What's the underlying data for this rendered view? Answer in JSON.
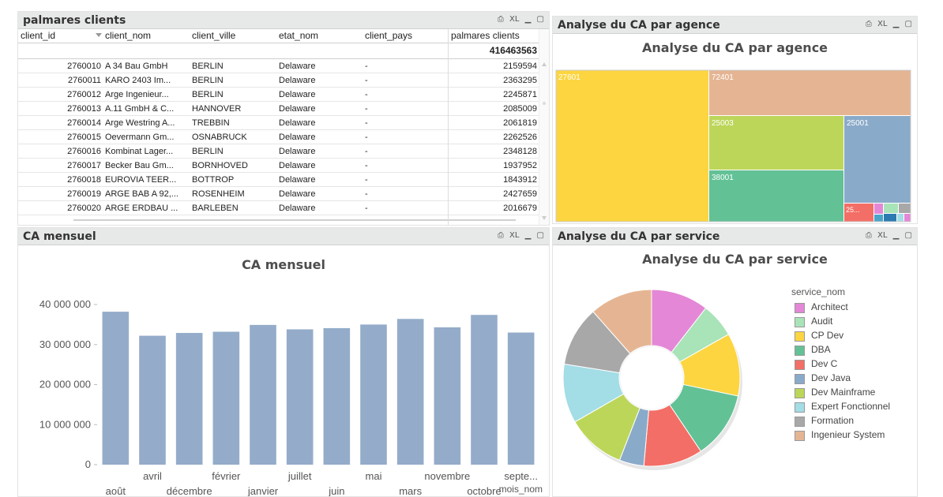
{
  "palmares": {
    "title": "palmares clients",
    "tools": {
      "print": "⎙",
      "xl": "XL",
      "min": "▁",
      "max": "▢"
    },
    "columns": [
      "client_id",
      "client_nom",
      "client_ville",
      "etat_nom",
      "client_pays",
      "palmares clients"
    ],
    "total": "416463563",
    "rows": [
      [
        "2760010",
        "A 34 Bau GmbH",
        "BERLIN",
        "Delaware",
        "-",
        "2159594"
      ],
      [
        "2760011",
        "KARO 2403 Im...",
        "BERLIN",
        "Delaware",
        "-",
        "2363295"
      ],
      [
        "2760012",
        "Arge Ingenieur...",
        "BERLIN",
        "Delaware",
        "-",
        "2245871"
      ],
      [
        "2760013",
        "A.11 GmbH & C...",
        "HANNOVER",
        "Delaware",
        "-",
        "2085009"
      ],
      [
        "2760014",
        "Arge Westring A...",
        "TREBBIN",
        "Delaware",
        "-",
        "2061819"
      ],
      [
        "2760015",
        "Oevermann Gm...",
        "OSNABRUCK",
        "Delaware",
        "-",
        "2262526"
      ],
      [
        "2760016",
        "Kombinat Lager...",
        "BERLIN",
        "Delaware",
        "-",
        "2348128"
      ],
      [
        "2760017",
        "Becker Bau Gm...",
        "BORNHOVED",
        "Delaware",
        "-",
        "1937952"
      ],
      [
        "2760018",
        "EUROVIA TEER...",
        "BOTTROP",
        "Delaware",
        "-",
        "1843912"
      ],
      [
        "2760019",
        "ARGE BAB A 92,...",
        "ROSENHEIM",
        "Delaware",
        "-",
        "2427659"
      ],
      [
        "2760020",
        "ARGE ERDBAU ...",
        "BARLEBEN",
        "Delaware",
        "-",
        "2016679"
      ]
    ]
  },
  "agence": {
    "title": "Analyse du CA par agence",
    "chart_title": "Analyse du CA par agence",
    "tools": {
      "print": "⎙",
      "xl": "XL",
      "min": "▁",
      "max": "▢"
    },
    "labels": {
      "a27601": "27601",
      "a72401": "72401",
      "a25003": "25003",
      "a25001": "25001",
      "a38001": "38001",
      "a25small": "25..."
    },
    "colors": {
      "a27601": "#fcd540",
      "a72401": "#e5b593",
      "a25003": "#bcd65a",
      "a25001": "#8aaac9",
      "a38001": "#63c196",
      "a25small": "#f36e66"
    }
  },
  "mensuel": {
    "title": "CA mensuel",
    "tools": {
      "print": "⎙",
      "xl": "XL",
      "min": "▁",
      "max": "▢"
    }
  },
  "service": {
    "title": "Analyse du CA par service",
    "tools": {
      "print": "⎙",
      "xl": "XL",
      "min": "▁",
      "max": "▢"
    }
  },
  "chart_data": [
    {
      "type": "bar",
      "title": "CA mensuel",
      "xlabel": "mois_nom",
      "ylabel": "",
      "categories": [
        "août",
        "avril",
        "décembre",
        "février",
        "janvier",
        "juillet",
        "juin",
        "mai",
        "mars",
        "novembre",
        "octobre",
        "septe..."
      ],
      "values": [
        38200000,
        32200000,
        32900000,
        33200000,
        34900000,
        33800000,
        34100000,
        35000000,
        36400000,
        34300000,
        37400000,
        33000000
      ],
      "ylim": [
        0,
        40000000
      ],
      "yticks": [
        "0",
        "10 000 000",
        "20 000 000",
        "30 000 000",
        "40 000 000"
      ],
      "ytick_values": [
        0,
        10000000,
        20000000,
        30000000,
        40000000
      ],
      "bar_color": "#94acca",
      "grid": false
    },
    {
      "type": "pie",
      "title": "Analyse du CA par service",
      "legend_title": "service_nom",
      "legend_position": "right",
      "categories": [
        "Architect",
        "Audit",
        "CP Dev",
        "DBA",
        "Dev C",
        "Dev Java",
        "Dev Mainframe",
        "Expert Fonctionnel",
        "Formation",
        "Ingenieur System"
      ],
      "values": [
        10.5,
        6.3,
        11.5,
        12.3,
        10.8,
        4.5,
        10.8,
        10.8,
        11.0,
        11.5
      ],
      "colors": [
        "#e487d6",
        "#a9e3b8",
        "#fcd540",
        "#63c196",
        "#f36e66",
        "#8aaac9",
        "#bcd65a",
        "#a3dde6",
        "#a8a8a8",
        "#e5b593"
      ],
      "donut": true
    }
  ]
}
